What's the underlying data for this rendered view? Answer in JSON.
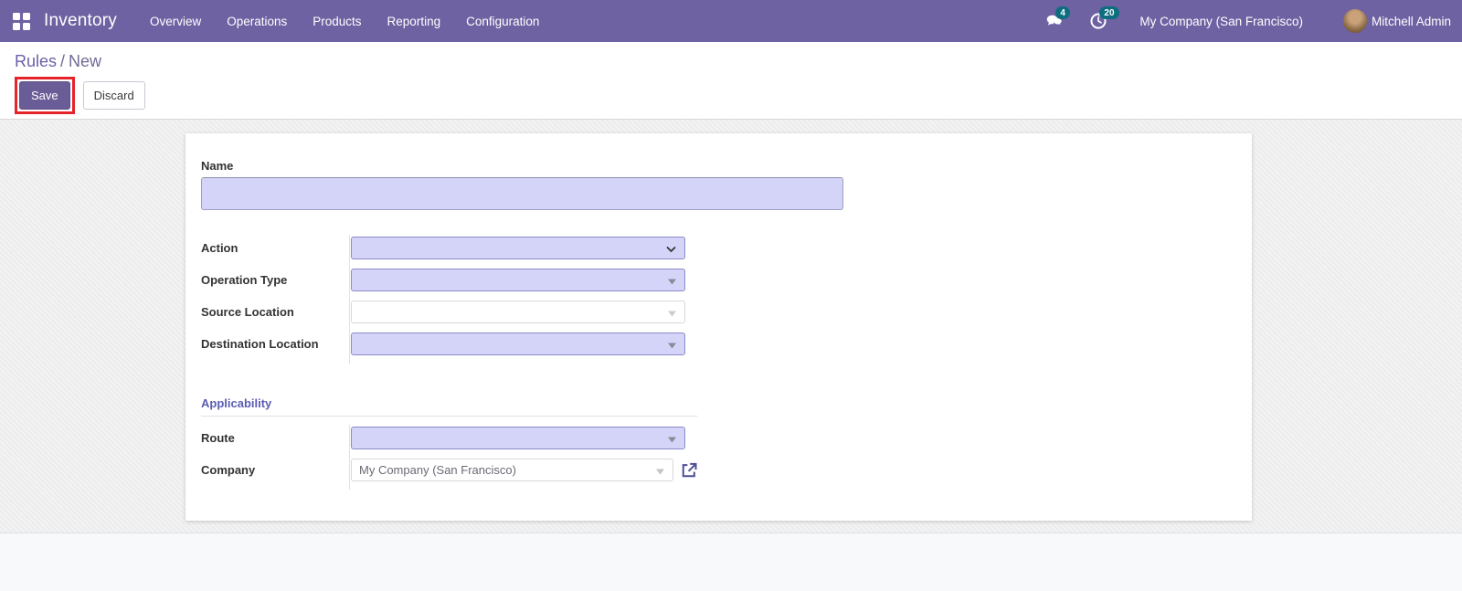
{
  "topbar": {
    "app_name": "Inventory",
    "menu_items": [
      "Overview",
      "Operations",
      "Products",
      "Reporting",
      "Configuration"
    ],
    "badges": {
      "messages": "4",
      "activities": "20"
    },
    "icons": {
      "apps": "grid-icon",
      "messages": "chat-bubbles-icon",
      "activities": "clock-icon"
    },
    "company": "My Company (San Francisco)",
    "user": "Mitchell Admin"
  },
  "breadcrumb": {
    "parent": "Rules",
    "separator": "/",
    "current": "New"
  },
  "actions": {
    "save": "Save",
    "discard": "Discard"
  },
  "form": {
    "sections": {
      "applicability": "Applicability"
    },
    "fields": {
      "name": {
        "label": "Name",
        "value": ""
      },
      "action": {
        "label": "Action",
        "value": ""
      },
      "operation_type": {
        "label": "Operation Type",
        "value": ""
      },
      "source_location": {
        "label": "Source Location",
        "value": ""
      },
      "destination_location": {
        "label": "Destination Location",
        "value": ""
      },
      "route": {
        "label": "Route",
        "value": ""
      },
      "company": {
        "label": "Company",
        "value": "My Company (San Francisco)"
      }
    }
  },
  "colors": {
    "navbar": "#6e62a2",
    "primary_button": "#6a5c96",
    "badge": "#0d6e80",
    "field_highlight": "#d4d4f8",
    "annotation": "#e3242b",
    "section_title": "#5b5cb3"
  }
}
